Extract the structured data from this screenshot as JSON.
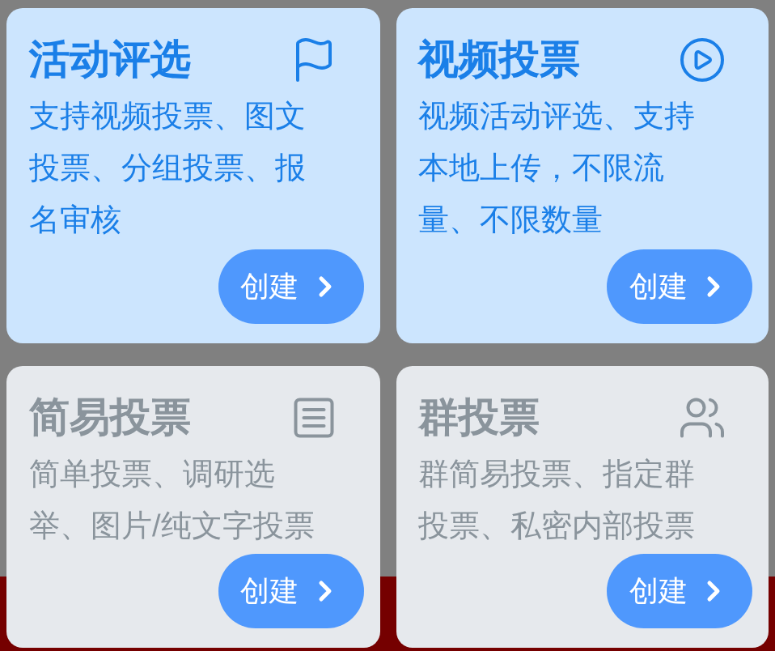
{
  "cards": [
    {
      "title": "活动评选",
      "description": "支持视频投票、图文投票、分组投票、报名审核",
      "kind": "flag",
      "button": "创建",
      "disabled": false
    },
    {
      "title": "视频投票",
      "description": "视频活动评选、支持本地上传，不限流量、不限数量",
      "kind": "play",
      "button": "创建",
      "disabled": false
    },
    {
      "title": "简易投票",
      "description": "简单投票、调研选举、图片/纯文字投票",
      "kind": "list",
      "button": "创建",
      "disabled": true
    },
    {
      "title": "群投票",
      "description": "群简易投票、指定群投票、私密内部投票",
      "kind": "group",
      "button": "创建",
      "disabled": true
    }
  ]
}
